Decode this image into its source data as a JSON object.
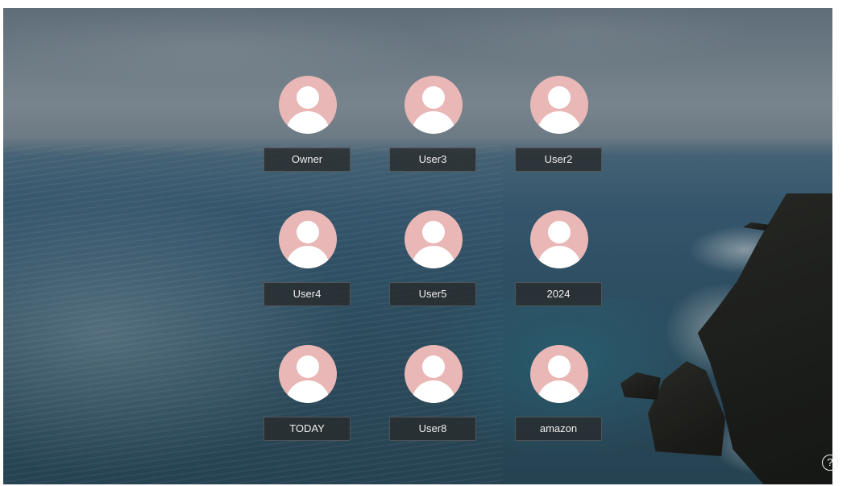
{
  "users": [
    {
      "name": "Owner"
    },
    {
      "name": "User3"
    },
    {
      "name": "User2"
    },
    {
      "name": "User4"
    },
    {
      "name": "User5"
    },
    {
      "name": "2024"
    },
    {
      "name": "TODAY"
    },
    {
      "name": "User8"
    },
    {
      "name": "amazon"
    }
  ],
  "help": {
    "label": "?"
  },
  "colors": {
    "avatar_background": "#e8b7b6",
    "avatar_silhouette": "#ffffff",
    "name_button_background": "#2b2d2f",
    "name_text": "#eeeeee"
  },
  "icons": {
    "avatar": "user-silhouette-icon",
    "help": "question-mark-icon"
  }
}
